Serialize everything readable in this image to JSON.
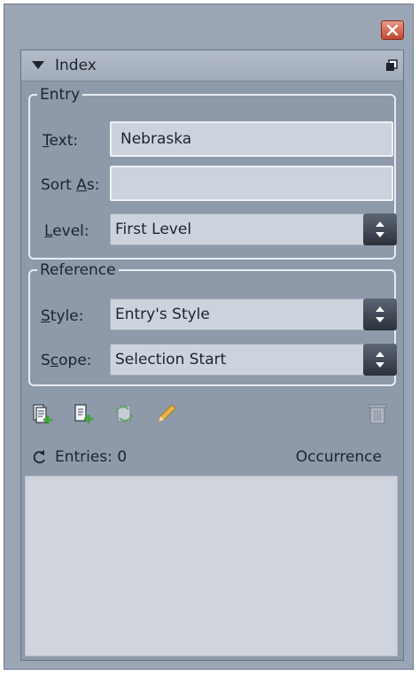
{
  "panel": {
    "title": "Index"
  },
  "entry": {
    "legend": "Entry",
    "text_label_prefix": "T",
    "text_label_u": "",
    "text_label_rest": "ext:",
    "text_value": "Nebraska",
    "sort_label_prefix": "Sort ",
    "sort_label_u": "A",
    "sort_label_rest": "s:",
    "sort_value": "",
    "level_label_u": "L",
    "level_label_rest": "evel:",
    "level_value": "First Level"
  },
  "reference": {
    "legend": "Reference",
    "style_label_u": "S",
    "style_label_rest": "tyle:",
    "style_value": "Entry's Style",
    "scope_label_prefix": "S",
    "scope_label_u": "c",
    "scope_label_rest": "ope:",
    "scope_value": "Selection Start"
  },
  "list": {
    "entries_label": "Entries: 0",
    "occurrence_label": "Occurrence"
  },
  "icons": {
    "close": "close-icon",
    "collapse": "triangle-down-icon",
    "panel_menu": "panel-menu-icon",
    "new_entry": "new-entry-icon",
    "new_page_ref": "new-page-reference-icon",
    "update_preview": "update-preview-icon",
    "edit": "pencil-icon",
    "delete": "trash-icon",
    "refresh": "refresh-icon"
  },
  "colors": {
    "window_bg": "#9aa6b6",
    "panel_bg": "#8e99a9",
    "field_bg": "#cdd3dd",
    "close_red": "#c4452f"
  }
}
